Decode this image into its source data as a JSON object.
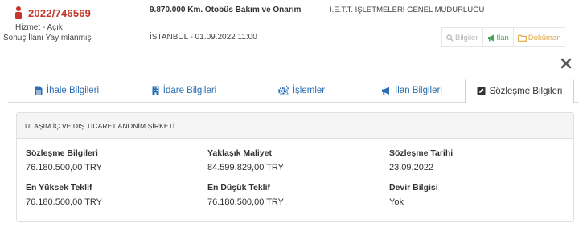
{
  "tender": {
    "id": "2022/746569",
    "type_status": "Hizmet - Açık",
    "result": "Sonuç İlanı Yayımlanmış",
    "title": "9.870.000 Km. Otobüs Bakım ve Onarım",
    "authority": "İ.E.T.T. İŞLETMELERİ GENEL MÜDÜRLÜĞÜ",
    "place_date": "İSTANBUL - 01.09.2022 11:00"
  },
  "actions": {
    "info": "Bilgiler",
    "notice": "İlan",
    "document": "Doküman"
  },
  "tabs": [
    {
      "label": "İhale Bilgileri",
      "icon": "file-text-icon"
    },
    {
      "label": "İdare Bilgileri",
      "icon": "building-icon"
    },
    {
      "label": "İşlemler",
      "icon": "gears-icon"
    },
    {
      "label": "İlan Bilgileri",
      "icon": "bullhorn-icon"
    },
    {
      "label": "Sözleşme Bilgileri",
      "icon": "edit-icon",
      "active": true
    }
  ],
  "contract": {
    "company": "ULAŞIM İÇ VE DIŞ TİCARET ANONİM ŞİRKETİ",
    "fields": [
      {
        "label": "Sözleşme Bilgileri",
        "value": "76.180.500,00 TRY"
      },
      {
        "label": "Yaklaşık Maliyet",
        "value": "84.599.829,00 TRY"
      },
      {
        "label": "Sözleşme Tarihi",
        "value": "23.09.2022"
      },
      {
        "label": "En Yüksek Teklif",
        "value": "76.180.500,00 TRY"
      },
      {
        "label": "En Düşük Teklif",
        "value": "76.180.500,00 TRY"
      },
      {
        "label": "Devir Bilgisi",
        "value": "Yok"
      }
    ]
  },
  "colors": {
    "id_red": "#c0392b",
    "link_blue": "#2a6eb3",
    "notice_green": "#4aa35a",
    "document_orange": "#e0a43a"
  }
}
